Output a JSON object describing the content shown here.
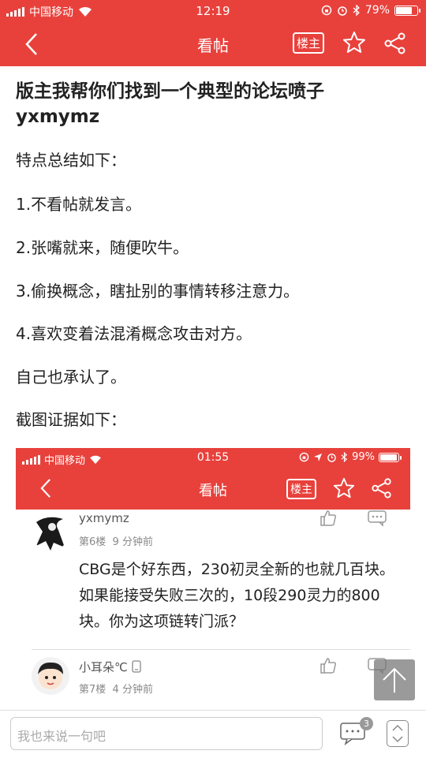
{
  "status_bar": {
    "carrier": "中国移动",
    "time": "12:19",
    "battery_percent": "79%"
  },
  "navbar": {
    "title": "看帖",
    "owner_label": "楼主"
  },
  "post": {
    "heading_line1": "版主我帮你们找到一个典型的论坛喷子",
    "heading_line2": "yxmymz",
    "paragraphs": [
      "特点总结如下：",
      "1.不看帖就发言。",
      "2.张嘴就来，随便吹牛。",
      "3.偷换概念，瞎扯别的事情转移注意力。",
      "4.喜欢变着法混淆概念攻击对方。",
      "自己也承认了。",
      "截图证据如下："
    ]
  },
  "screenshot": {
    "status_bar": {
      "carrier": "中国移动",
      "time": "01:55",
      "battery_percent": "99%"
    },
    "navbar": {
      "title": "看帖",
      "owner_label": "楼主"
    },
    "replies": [
      {
        "username": "yxmymz",
        "floor": "第6楼",
        "time_ago": "9 分钟前",
        "content": "CBG是个好东西，230初灵全新的也就几百块。如果能接受失败三次的，10段290灵力的800块。你为这项链转门派？"
      },
      {
        "username": "小耳朵℃",
        "floor": "第7楼",
        "time_ago": "4 分钟前"
      }
    ]
  },
  "bottom_bar": {
    "input_placeholder": "我也来说一句吧",
    "comment_count": "3"
  },
  "colors": {
    "accent": "#e8413c"
  }
}
